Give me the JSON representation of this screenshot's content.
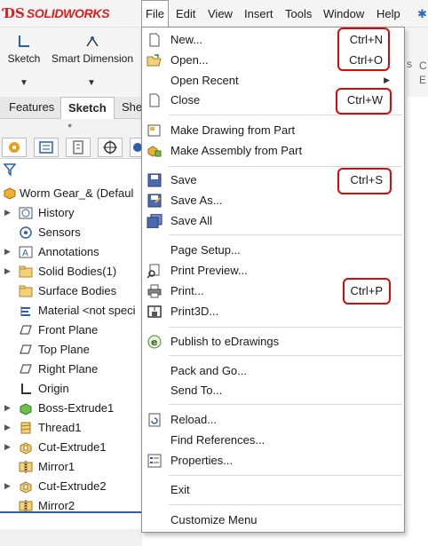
{
  "app": {
    "brand": "SOLIDWORKS"
  },
  "menubar": {
    "items": [
      {
        "label": "File",
        "active": true
      },
      {
        "label": "Edit"
      },
      {
        "label": "View"
      },
      {
        "label": "Insert"
      },
      {
        "label": "Tools"
      },
      {
        "label": "Window"
      },
      {
        "label": "Help"
      }
    ]
  },
  "command_manager": {
    "sketch": "Sketch",
    "smart_dimension": "Smart Dimension",
    "right_partial_1": "s",
    "right_partial_2": "C",
    "right_partial_3": "E"
  },
  "tabs": [
    "Features",
    "Sketch",
    "She"
  ],
  "tree": {
    "root": "Worm Gear_&  (Defaul",
    "items": [
      "History",
      "Sensors",
      "Annotations",
      "Solid Bodies(1)",
      "Surface Bodies",
      "Material <not speci",
      "Front Plane",
      "Top Plane",
      "Right Plane",
      "Origin",
      "Boss-Extrude1",
      "Thread1",
      "Cut-Extrude1",
      "Mirror1",
      "Cut-Extrude2",
      "Mirror2"
    ]
  },
  "file_menu": {
    "new": "New...",
    "new_sc": "Ctrl+N",
    "open": "Open...",
    "open_sc": "Ctrl+O",
    "open_recent": "Open Recent",
    "close": "Close",
    "close_sc": "Ctrl+W",
    "make_drawing": "Make Drawing from Part",
    "make_assembly": "Make Assembly from Part",
    "save": "Save",
    "save_sc": "Ctrl+S",
    "save_as": "Save As...",
    "save_all": "Save All",
    "page_setup": "Page Setup...",
    "print_preview": "Print Preview...",
    "print": "Print...",
    "print_sc": "Ctrl+P",
    "print3d": "Print3D...",
    "publish": "Publish to eDrawings",
    "pack_go": "Pack and Go...",
    "send_to": "Send To...",
    "reload": "Reload...",
    "find_refs": "Find References...",
    "properties": "Properties...",
    "exit": "Exit",
    "customize": "Customize Menu"
  },
  "colors": {
    "highlight": "#d40b0b",
    "brand": "#d81e1e"
  }
}
